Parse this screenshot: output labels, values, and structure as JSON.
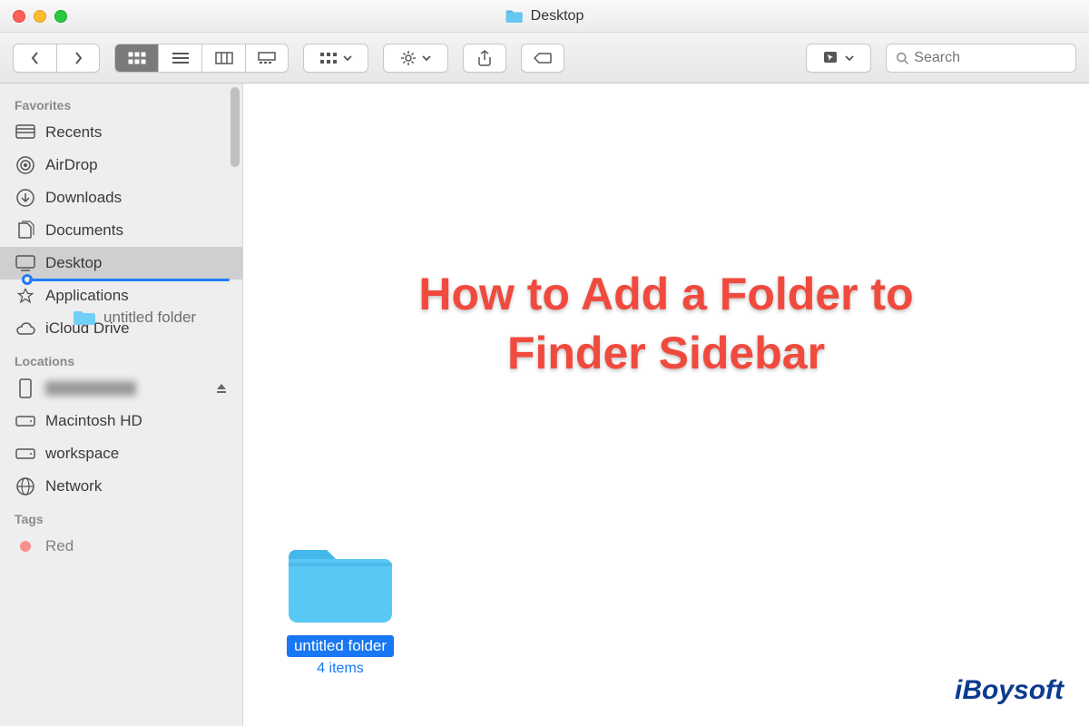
{
  "window": {
    "title": "Desktop"
  },
  "toolbar": {
    "search_placeholder": "Search"
  },
  "sidebar": {
    "sections": {
      "favorites": {
        "header": "Favorites",
        "items": [
          "Recents",
          "AirDrop",
          "Downloads",
          "Documents",
          "Desktop",
          "Applications",
          "iCloud Drive"
        ]
      },
      "locations": {
        "header": "Locations",
        "items": [
          "",
          "Macintosh HD",
          "workspace",
          "Network"
        ]
      },
      "tags": {
        "header": "Tags",
        "items": [
          "Red"
        ]
      }
    }
  },
  "drag": {
    "ghost_label": "untitled folder"
  },
  "overlay": {
    "line1": "How to Add a Folder to",
    "line2": "Finder Sidebar"
  },
  "folder": {
    "name": "untitled folder",
    "subtitle": "4 items"
  },
  "watermark": "iBoysoft"
}
